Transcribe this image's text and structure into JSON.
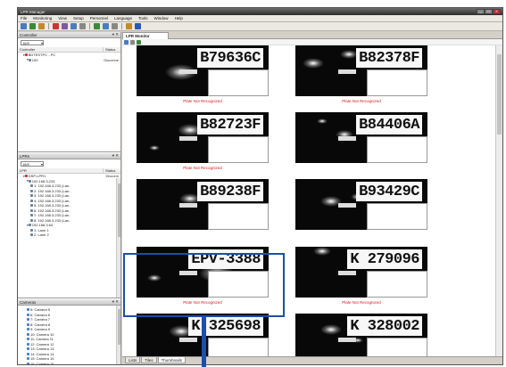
{
  "app": {
    "title": "LPR Manager",
    "window_buttons": [
      "_",
      "□",
      "X"
    ]
  },
  "menu": [
    "File",
    "Monitoring",
    "View",
    "Setup",
    "Personnel",
    "Language",
    "Tools",
    "Window",
    "Help"
  ],
  "toolbar": {
    "icons": [
      "connect-icon",
      "disconnect-icon",
      "settings-icon",
      "camera-icon",
      "record-icon",
      "user-icon",
      "grid-icon",
      "list-icon",
      "search-icon",
      "print-icon",
      "export-icon",
      "help-icon"
    ],
    "colors": [
      "#4a7cc0",
      "#3a8a3a",
      "#c28a2b",
      "#c33",
      "#7a5aa0",
      "#4a7cc0",
      "#888",
      "#3a8a3a",
      "#4a7cc0",
      "#888",
      "#c28a2b",
      "#2a5ab0"
    ]
  },
  "controller_pane": {
    "title": "Controller",
    "combo": "16/9",
    "col_name": "Controller",
    "col_status": "Status",
    "rows": [
      {
        "label": "BDTESTPC - PC",
        "status": "",
        "indent": 1
      },
      {
        "label": "100",
        "status": "Disconne",
        "indent": 2
      }
    ]
  },
  "lpr_pane": {
    "title": "LPRs",
    "combo": "16/9",
    "col_name": "LPR",
    "col_status": "Status",
    "rows": [
      {
        "label": "DSP-LPR1",
        "status": "Disconn",
        "indent": 1
      },
      {
        "label": "192.168.3.233",
        "status": "",
        "indent": 2
      },
      {
        "label": "1: 192.168.3.233 (Lan..",
        "status": "",
        "indent": 3
      },
      {
        "label": "2: 192.168.3.233 (Lan..",
        "status": "",
        "indent": 3
      },
      {
        "label": "3: 192.168.3.233 (Lan..",
        "status": "",
        "indent": 3
      },
      {
        "label": "4: 192.168.3.233 (Lan..",
        "status": "",
        "indent": 3
      },
      {
        "label": "5: 192.168.3.233 (Lan..",
        "status": "",
        "indent": 3
      },
      {
        "label": "6: 192.168.3.233 (Lan..",
        "status": "",
        "indent": 3
      },
      {
        "label": "7: 192.168.3.233 (Lan..",
        "status": "",
        "indent": 3
      },
      {
        "label": "8: 192.168.3.233 (Lan..",
        "status": "",
        "indent": 3
      },
      {
        "label": "192.168.3.64",
        "status": "",
        "indent": 2
      },
      {
        "label": "1: Lane 1",
        "status": "",
        "indent": 3
      },
      {
        "label": "2: Lane 2",
        "status": "",
        "indent": 3
      }
    ]
  },
  "camera_pane": {
    "title": "Cameras",
    "rows": [
      "5: Camera 5",
      "6: Camera 6",
      "7: Camera 7",
      "8: Camera 8",
      "9: Camera 9",
      "10: Camera 10",
      "11: Camera 11",
      "12: Camera 12",
      "13: Camera 13",
      "14: Camera 14",
      "15: Camera 15",
      "16: Camera 16"
    ]
  },
  "main": {
    "doc_tab": "LPR Monitor",
    "bottom_tabs": [
      "Lists",
      "Tiles",
      "Thumbnails"
    ],
    "active_bottom_tab": "Thumbnails",
    "tiles": [
      {
        "plate": "B79636C",
        "status": "Plate Not Recognized"
      },
      {
        "plate": "B82378F",
        "status": "Plate Not Recognized"
      },
      {
        "plate": "B82723F",
        "status": "Plate Not Recognized"
      },
      {
        "plate": "B84406A",
        "status": ""
      },
      {
        "plate": "B89238F",
        "status": ""
      },
      {
        "plate": "B93429C",
        "status": ""
      },
      {
        "plate": "EPV-3388",
        "status": "Plate Not Recognized"
      },
      {
        "plate": "K 279096",
        "status": "Plate Not Recognized"
      },
      {
        "plate": "K 325698",
        "status": ""
      },
      {
        "plate": "K 328002",
        "status": ""
      }
    ]
  },
  "colors": {
    "highlight": "#1e4ea8",
    "not_recognized": "#d02020"
  }
}
